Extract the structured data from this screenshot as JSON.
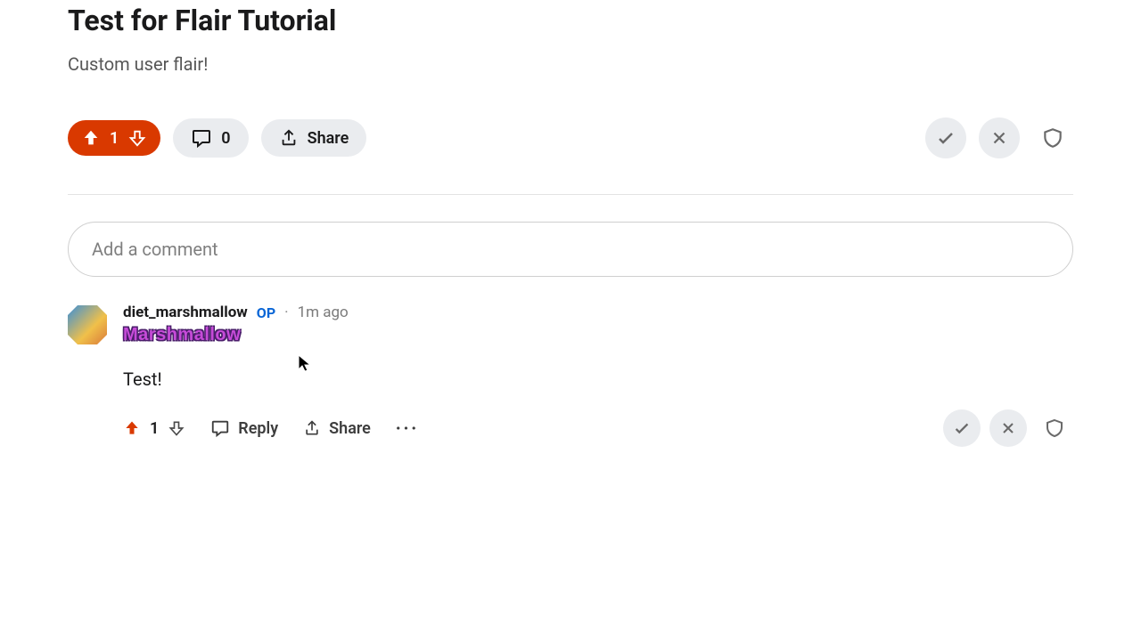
{
  "post": {
    "title": "Test for Flair Tutorial",
    "body": "Custom user flair!",
    "vote_count": "1",
    "comment_count": "0",
    "share_label": "Share"
  },
  "comment_input": {
    "placeholder": "Add a comment"
  },
  "comment": {
    "username": "diet_marshmallow",
    "op_label": "OP",
    "separator": "·",
    "time": "1m ago",
    "flair_text": "Marshmallow",
    "body": "Test!",
    "vote_count": "1",
    "reply_label": "Reply",
    "share_label": "Share"
  }
}
